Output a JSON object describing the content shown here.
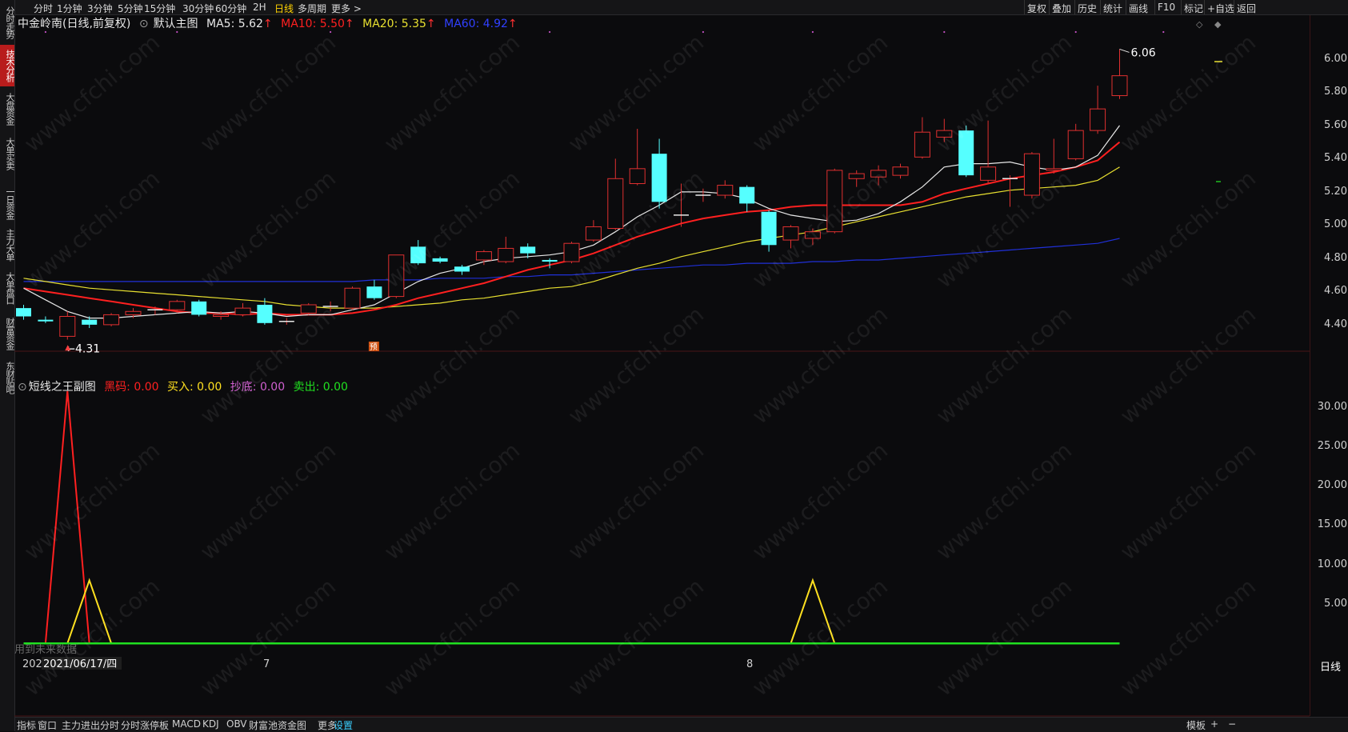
{
  "sidebar": {
    "items": [
      {
        "label": "分时走势",
        "active": false
      },
      {
        "label": "技术分析",
        "active": true
      },
      {
        "label": "大盘资金",
        "active": false
      },
      {
        "label": "大单买卖",
        "active": false
      },
      {
        "label": "一日资金",
        "active": false
      },
      {
        "label": "主力大单",
        "active": false
      },
      {
        "label": "大单盘口",
        "active": false
      },
      {
        "label": "财富资金",
        "active": false
      },
      {
        "label": "东财贴吧",
        "active": false
      }
    ]
  },
  "topbar": {
    "periods": [
      "分时",
      "1分钟",
      "3分钟",
      "5分钟",
      "15分钟",
      "30分钟",
      "60分钟",
      "2H",
      "日线",
      "多周期",
      "更多 >"
    ],
    "active_period": "日线",
    "right_buttons": [
      "复权",
      "叠加",
      "历史",
      "统计",
      "画线",
      "F10",
      "标记",
      "+自选",
      "返回"
    ]
  },
  "main_legend": {
    "stock": "中金岭南(日线,前复权)",
    "template": "默认主图",
    "ma5": "MA5: 5.62",
    "ma10": "MA10: 5.50",
    "ma20": "MA20: 5.35",
    "ma60": "MA60: 4.92",
    "arrow": "↑"
  },
  "sub_legend": {
    "name": "短线之王副图",
    "heima": "黑码: 0.00",
    "buy": "买入: 0.00",
    "bottom": "抄底: 0.00",
    "sell": "卖出: 0.00"
  },
  "annotations": {
    "high": "6.06",
    "low": "←4.31",
    "pre": "预",
    "future_note": "用到未来数据"
  },
  "x_labels": {
    "left_date": "2021/06/17/四",
    "left_prefix": "202",
    "m7": "7",
    "m8": "8",
    "period": "日线"
  },
  "bottombar": {
    "items": [
      "指标",
      "窗口",
      "主力进出分时",
      "分时涨停板",
      "MACD",
      "KDJ",
      "OBV",
      "财富池资金图",
      "更多",
      "设置"
    ],
    "active": "设置",
    "right": [
      "模板",
      "+",
      "−"
    ]
  },
  "watermark": "www.cfchi.com",
  "colors": {
    "up": "#e03030",
    "down": "#55ffff",
    "ma5": "#e8e8e8",
    "ma10": "#ff2020",
    "ma20": "#e8e030",
    "ma60": "#2030d8",
    "heima": "#ff2020",
    "buy": "#ffe020",
    "bottom": "#d060d0",
    "sell": "#20e020"
  },
  "chart_data": [
    {
      "type": "candlestick",
      "title": "中金岭南(日线,前复权)",
      "ylim": [
        4.25,
        6.12
      ],
      "yticks": [
        6.0,
        5.8,
        5.6,
        5.4,
        5.2,
        5.0,
        4.8,
        4.6,
        4.4
      ],
      "candles": [
        [
          4.5,
          4.45,
          4.52,
          4.43
        ],
        [
          4.43,
          4.42,
          4.45,
          4.41
        ],
        [
          4.33,
          4.45,
          4.48,
          4.31
        ],
        [
          4.43,
          4.4,
          4.45,
          4.38
        ],
        [
          4.4,
          4.46,
          4.47,
          4.39
        ],
        [
          4.46,
          4.48,
          4.5,
          4.44
        ],
        [
          4.49,
          4.49,
          4.51,
          4.46
        ],
        [
          4.49,
          4.54,
          4.55,
          4.47
        ],
        [
          4.54,
          4.46,
          4.55,
          4.45
        ],
        [
          4.45,
          4.46,
          4.48,
          4.43
        ],
        [
          4.46,
          4.5,
          4.53,
          4.45
        ],
        [
          4.52,
          4.41,
          4.56,
          4.4
        ],
        [
          4.42,
          4.42,
          4.44,
          4.4
        ],
        [
          4.47,
          4.52,
          4.53,
          4.46
        ],
        [
          4.51,
          4.51,
          4.54,
          4.48
        ],
        [
          4.5,
          4.62,
          4.63,
          4.49
        ],
        [
          4.63,
          4.56,
          4.67,
          4.55
        ],
        [
          4.57,
          4.82,
          4.82,
          4.56
        ],
        [
          4.87,
          4.77,
          4.91,
          4.76
        ],
        [
          4.8,
          4.78,
          4.81,
          4.77
        ],
        [
          4.75,
          4.72,
          4.76,
          4.7
        ],
        [
          4.79,
          4.84,
          4.85,
          4.76
        ],
        [
          4.78,
          4.86,
          4.93,
          4.77
        ],
        [
          4.87,
          4.83,
          4.89,
          4.8
        ],
        [
          4.79,
          4.78,
          4.8,
          4.74
        ],
        [
          4.78,
          4.89,
          4.9,
          4.77
        ],
        [
          4.91,
          4.99,
          5.03,
          4.9
        ],
        [
          4.98,
          5.28,
          5.4,
          4.97
        ],
        [
          5.25,
          5.34,
          5.58,
          5.24
        ],
        [
          5.43,
          5.14,
          5.52,
          5.1
        ],
        [
          5.06,
          5.06,
          5.25,
          4.99
        ],
        [
          5.18,
          5.18,
          5.22,
          5.14
        ],
        [
          5.18,
          5.24,
          5.27,
          5.16
        ],
        [
          5.23,
          5.13,
          5.24,
          5.08
        ],
        [
          5.08,
          4.88,
          5.09,
          4.84
        ],
        [
          4.91,
          4.99,
          5.0,
          4.86
        ],
        [
          4.92,
          4.96,
          4.98,
          4.88
        ],
        [
          4.96,
          5.33,
          5.34,
          4.95
        ],
        [
          5.28,
          5.31,
          5.33,
          5.23
        ],
        [
          5.29,
          5.33,
          5.36,
          5.24
        ],
        [
          5.3,
          5.35,
          5.37,
          5.28
        ],
        [
          5.41,
          5.56,
          5.65,
          5.4
        ],
        [
          5.53,
          5.57,
          5.64,
          5.5
        ],
        [
          5.57,
          5.3,
          5.6,
          5.29
        ],
        [
          5.27,
          5.35,
          5.63,
          5.25
        ],
        [
          5.28,
          5.28,
          5.3,
          5.11
        ],
        [
          5.18,
          5.43,
          5.44,
          5.16
        ],
        [
          5.33,
          5.34,
          5.52,
          5.31
        ],
        [
          5.4,
          5.57,
          5.61,
          5.39
        ],
        [
          5.57,
          5.7,
          5.84,
          5.55
        ],
        [
          5.78,
          5.9,
          6.06,
          5.76
        ]
      ],
      "ma5": [
        4.62,
        4.55,
        4.48,
        4.44,
        4.44,
        4.45,
        4.46,
        4.47,
        4.48,
        4.47,
        4.48,
        4.47,
        4.45,
        4.46,
        4.46,
        4.49,
        4.52,
        4.59,
        4.66,
        4.71,
        4.74,
        4.78,
        4.8,
        4.81,
        4.82,
        4.84,
        4.88,
        4.96,
        5.05,
        5.12,
        5.2,
        5.2,
        5.19,
        5.16,
        5.1,
        5.06,
        5.04,
        5.02,
        5.03,
        5.07,
        5.14,
        5.23,
        5.35,
        5.37,
        5.37,
        5.38,
        5.35,
        5.33,
        5.35,
        5.42,
        5.6
      ],
      "ma10": [
        4.62,
        4.6,
        4.58,
        4.56,
        4.54,
        4.52,
        4.5,
        4.48,
        4.47,
        4.47,
        4.46,
        4.47,
        4.46,
        4.46,
        4.46,
        4.47,
        4.49,
        4.52,
        4.56,
        4.59,
        4.62,
        4.65,
        4.69,
        4.73,
        4.76,
        4.79,
        4.83,
        4.88,
        4.93,
        4.97,
        5.01,
        5.04,
        5.06,
        5.08,
        5.09,
        5.11,
        5.12,
        5.12,
        5.12,
        5.12,
        5.12,
        5.14,
        5.19,
        5.22,
        5.25,
        5.28,
        5.3,
        5.32,
        5.35,
        5.39,
        5.5
      ],
      "ma20": [
        4.68,
        4.66,
        4.64,
        4.62,
        4.61,
        4.6,
        4.59,
        4.58,
        4.57,
        4.56,
        4.55,
        4.54,
        4.52,
        4.51,
        4.5,
        4.5,
        4.5,
        4.51,
        4.52,
        4.53,
        4.55,
        4.56,
        4.58,
        4.6,
        4.62,
        4.63,
        4.66,
        4.7,
        4.74,
        4.77,
        4.81,
        4.84,
        4.87,
        4.9,
        4.92,
        4.94,
        4.96,
        4.99,
        5.02,
        5.05,
        5.08,
        5.11,
        5.14,
        5.17,
        5.19,
        5.21,
        5.22,
        5.23,
        5.24,
        5.27,
        5.35
      ],
      "ma60": [
        4.66,
        4.66,
        4.66,
        4.66,
        4.66,
        4.66,
        4.66,
        4.66,
        4.66,
        4.66,
        4.66,
        4.66,
        4.66,
        4.66,
        4.66,
        4.66,
        4.67,
        4.67,
        4.67,
        4.68,
        4.68,
        4.68,
        4.69,
        4.69,
        4.7,
        4.7,
        4.71,
        4.72,
        4.73,
        4.74,
        4.75,
        4.76,
        4.76,
        4.77,
        4.77,
        4.77,
        4.78,
        4.78,
        4.79,
        4.79,
        4.8,
        4.81,
        4.82,
        4.83,
        4.84,
        4.85,
        4.86,
        4.87,
        4.88,
        4.89,
        4.92
      ]
    },
    {
      "type": "line",
      "title": "短线之王副图",
      "ylim": [
        -1,
        32
      ],
      "yticks": [
        30.0,
        25.0,
        20.0,
        15.0,
        10.0,
        5.0
      ],
      "series": [
        {
          "name": "黑码",
          "values": [
            0,
            0,
            32,
            0,
            0,
            0,
            0,
            0,
            0,
            0,
            0,
            0,
            0,
            0,
            0,
            0,
            0,
            0,
            0,
            0,
            0,
            0,
            0,
            0,
            0,
            0,
            0,
            0,
            0,
            0,
            0,
            0,
            0,
            0,
            0,
            0,
            0,
            0,
            0,
            0,
            0,
            0,
            0,
            0,
            0,
            0,
            0,
            0,
            0,
            0,
            0
          ]
        },
        {
          "name": "买入",
          "values": [
            0,
            0,
            0,
            8,
            0,
            0,
            0,
            0,
            0,
            0,
            0,
            0,
            0,
            0,
            0,
            0,
            0,
            0,
            0,
            0,
            0,
            0,
            0,
            0,
            0,
            0,
            0,
            0,
            0,
            0,
            0,
            0,
            0,
            0,
            0,
            0,
            8,
            0,
            0,
            0,
            0,
            0,
            0,
            0,
            0,
            0,
            0,
            0,
            0,
            0,
            0
          ]
        },
        {
          "name": "卖出",
          "values": [
            0,
            0,
            0,
            0,
            0,
            0,
            0,
            0,
            0,
            0,
            0,
            0,
            0,
            0,
            0,
            0,
            0,
            0,
            0,
            0,
            0,
            0,
            0,
            0,
            0,
            0,
            0,
            0,
            0,
            0,
            0,
            0,
            0,
            0,
            0,
            0,
            0,
            0,
            0,
            0,
            0,
            0,
            0,
            0,
            0,
            0,
            0,
            0,
            0,
            0,
            0
          ]
        }
      ]
    }
  ]
}
